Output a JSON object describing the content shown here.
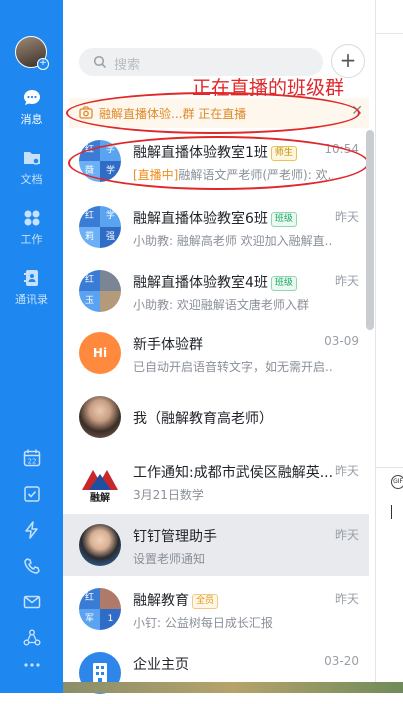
{
  "nav": {
    "items": [
      {
        "icon": "chat-bubble-icon",
        "label": "消息",
        "active": true
      },
      {
        "icon": "folder-icon",
        "label": "文档"
      },
      {
        "icon": "apps-grid-icon",
        "label": "工作"
      },
      {
        "icon": "contacts-book-icon",
        "label": "通讯录"
      }
    ],
    "bottom_icons": [
      "calendar-icon",
      "todo-check-icon",
      "lightning-icon",
      "phone-icon",
      "mail-icon",
      "org-network-icon",
      "more-dots-icon"
    ],
    "calendar_day": "22"
  },
  "search": {
    "placeholder": "搜索"
  },
  "annotation": "正在直播的班级群",
  "live_banner": {
    "text": "融解直播体验...群 正在直播"
  },
  "colors": {
    "accent": "#1f88f0",
    "annotation": "#e0282a",
    "live": "#e08a2a"
  },
  "conversations": [
    {
      "name": "融解直播体验教室1班",
      "tag": "师生",
      "tag_style": "g",
      "time": "10:54",
      "sub_prefix": "[直播中]",
      "sub": "融解语文严老师(严老师): 欢...",
      "avatar": [
        "红",
        "学",
        "薇",
        "学"
      ]
    },
    {
      "name": "融解直播体验教室6班",
      "tag": "班级",
      "tag_style": "t",
      "time": "昨天",
      "sub_prefix": "",
      "sub": "小助教: 融解高老师 欢迎加入融解直...",
      "avatar": [
        "红",
        "学",
        "莉",
        "强"
      ]
    },
    {
      "name": "融解直播体验教室4班",
      "tag": "班级",
      "tag_style": "t",
      "time": "昨天",
      "sub_prefix": "",
      "sub": "小助教: 欢迎融解语文唐老师入群",
      "avatar": [
        "红",
        "",
        "玉",
        ""
      ]
    },
    {
      "name": "新手体验群",
      "tag": "",
      "tag_style": "",
      "time": "03-09",
      "sub_prefix": "",
      "sub": "已自动开启语音转文字，如无需开启...",
      "avatar": [
        "Hi"
      ]
    },
    {
      "name": "我（融解教育高老师）",
      "tag": "",
      "tag_style": "",
      "time": "",
      "sub_prefix": "",
      "sub": "",
      "avatar": [
        "photo"
      ]
    },
    {
      "name": "工作通知:成都市武侯区融解英...",
      "tag": "",
      "tag_style": "",
      "time": "昨天",
      "sub_prefix": "",
      "sub": "3月21日数学",
      "avatar": [
        "融解"
      ]
    },
    {
      "name": "钉钉管理助手",
      "tag": "",
      "tag_style": "",
      "time": "昨天",
      "sub_prefix": "",
      "sub": "设置老师通知",
      "avatar": [
        "photo"
      ]
    },
    {
      "name": "融解教育",
      "tag": "全员",
      "tag_style": "o",
      "time": "昨天",
      "sub_prefix": "",
      "sub": "小钉: 公益树每日成长汇报",
      "avatar": [
        "红",
        "",
        "军",
        "1"
      ]
    },
    {
      "name": "企业主页",
      "tag": "",
      "tag_style": "",
      "time": "03-20",
      "sub_prefix": "",
      "sub": "",
      "avatar": [
        "building"
      ]
    }
  ]
}
